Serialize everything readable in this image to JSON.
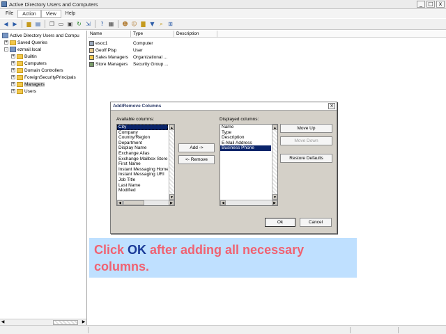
{
  "window": {
    "title": "Active Directory Users and Computers",
    "buttons": [
      "_",
      "□",
      "x"
    ]
  },
  "menu": [
    {
      "label": "File",
      "active": false
    },
    {
      "label": "Action",
      "active": true
    },
    {
      "label": "View",
      "active": true
    },
    {
      "label": "Help",
      "active": false
    }
  ],
  "tree": {
    "items": [
      {
        "label": "Active Directory Users and Compu",
        "expander": "",
        "level": 0,
        "icon": "root"
      },
      {
        "label": "Saved Queries",
        "expander": "+",
        "level": 1,
        "icon": "folder"
      },
      {
        "label": "ezmail.local",
        "expander": "-",
        "level": 1,
        "icon": "folder"
      },
      {
        "label": "Builtin",
        "expander": "+",
        "level": 2,
        "icon": "folder"
      },
      {
        "label": "Computers",
        "expander": "+",
        "level": 2,
        "icon": "folder"
      },
      {
        "label": "Domain Controllers",
        "expander": "+",
        "level": 2,
        "icon": "folder"
      },
      {
        "label": "ForeignSecurityPrincipals",
        "expander": "+",
        "level": 2,
        "icon": "folder"
      },
      {
        "label": "Managers",
        "expander": "+",
        "level": 2,
        "icon": "folder",
        "selected": true
      },
      {
        "label": "Users",
        "expander": "+",
        "level": 2,
        "icon": "folder"
      }
    ]
  },
  "list": {
    "columns": [
      "Name",
      "Type",
      "Description"
    ],
    "rows": [
      {
        "name": "esoc1",
        "type": "Computer",
        "icon_color": "#9aa9bd"
      },
      {
        "name": "Geoff Pisp",
        "type": "User",
        "icon_color": "#e8c98f"
      },
      {
        "name": "Sales Managers",
        "type": "Organizational ...",
        "icon_color": "#f3c84b"
      },
      {
        "name": "Store Managers",
        "type": "Security Group ...",
        "icon_color": "#7a9c6a"
      }
    ]
  },
  "dialog": {
    "title": "Add/Remove Columns",
    "available_label": "Available columns:",
    "displayed_label": "Displayed columns:",
    "available": [
      "City",
      "Company",
      "Country/Region",
      "Department",
      "Display Name",
      "Exchange Alias",
      "Exchange Mailbox Store",
      "First Name",
      "Instant Messaging Home",
      "Instant Messaging URI",
      "Job Title",
      "Last Name",
      "Modified"
    ],
    "displayed": [
      "Name",
      "Type",
      "Description",
      "E-Mail Address",
      "Business Phone"
    ],
    "add_label": "Add ->",
    "remove_label": "<- Remove",
    "move_up_label": "Move Up",
    "move_down_label": "Move Down",
    "restore_label": "Restore Defaults",
    "ok_label": "Ok",
    "cancel_label": "Cancel"
  },
  "callout": {
    "pre": "Click ",
    "highlight": "OK",
    "post": " after adding all necessary columns."
  },
  "colors": {
    "selection": "#0a246a",
    "callout_bg": "#bfe0ff",
    "callout_text": "#f06272",
    "callout_highlight": "#1a3a98"
  }
}
